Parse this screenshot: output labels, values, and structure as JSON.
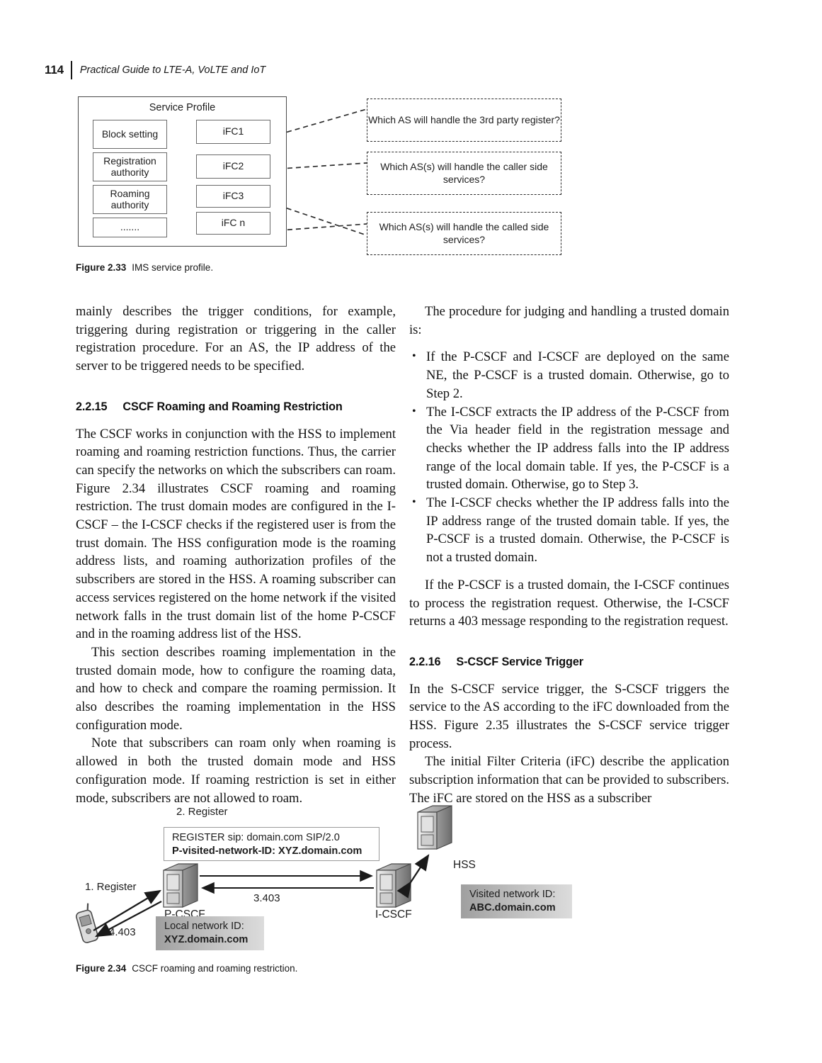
{
  "running_head": {
    "page_number": "114",
    "book_title": "Practical Guide to LTE-A, VoLTE and IoT"
  },
  "figure_233": {
    "caption_label": "Figure 2.33",
    "caption_text": "IMS service profile.",
    "panel_title": "Service Profile",
    "left_boxes": [
      "Block setting",
      "Registration authority",
      "Roaming authority",
      "......."
    ],
    "ifc_boxes": [
      "iFC1",
      "iFC2",
      "iFC3",
      "iFC n"
    ],
    "question_boxes": [
      "Which AS will handle the 3rd party register?",
      "Which AS(s) will handle the caller side services?",
      "Which AS(s) will handle the called side services?"
    ]
  },
  "body": {
    "left_column": {
      "para_1": "mainly describes the trigger conditions, for example, triggering during registration or triggering in the caller registration procedure. For an AS, the IP address of the server to be triggered needs to be specified.",
      "section_number": "2.2.15",
      "section_title": "CSCF Roaming and Roaming Restriction",
      "para_2": "The CSCF works in conjunction with the HSS to implement roaming and roaming restriction functions. Thus, the carrier can specify the networks on which the subscribers can roam. Figure 2.34 illustrates CSCF roaming and roaming restriction. The trust domain modes are configured in the I-CSCF – the I-CSCF checks if the registered user is from the trust domain. The HSS configuration mode is the roaming address lists, and roaming authorization profiles of the subscribers are stored in the HSS. A roaming subscriber can access services registered on the home network if the visited network falls in the trust domain list of the home P-CSCF and in the roaming address list of the HSS.",
      "para_3": "This section describes roaming implementation in the trusted domain mode, how to configure the roaming data, and how to check and compare the roaming permission. It also describes the roaming implementation in the HSS configuration mode.",
      "para_4": "Note that subscribers can roam only when roaming is allowed in both the trusted domain mode and HSS configuration mode. If roaming restriction is set in either mode, subscribers are not allowed to roam."
    },
    "right_column": {
      "para_1": "The procedure for judging and handling a trusted domain is:",
      "bullets": [
        "If the P-CSCF and I-CSCF are deployed on the same NE, the P-CSCF is a trusted domain. Otherwise, go to Step 2.",
        "The I-CSCF extracts the IP address of the P-CSCF from the Via header field in the registration message and checks whether the IP address falls into the IP address range of the local domain table. If yes, the P-CSCF is a trusted domain. Otherwise, go to Step 3.",
        "The I-CSCF checks whether the IP address falls into the IP address range of the trusted domain table. If yes, the P-CSCF is a trusted domain. Otherwise, the P-CSCF is not a trusted domain."
      ],
      "para_2": "If the P-CSCF is a trusted domain, the I-CSCF continues to process the registration request. Otherwise, the I-CSCF returns a 403 message responding to the registration request.",
      "section_number": "2.2.16",
      "section_title": "S-CSCF Service Trigger",
      "para_3": "In the S-CSCF service trigger, the S-CSCF triggers the service to the AS according to the iFC downloaded from the HSS. Figure 2.35 illustrates the S-CSCF service trigger process.",
      "para_4": "The initial Filter Criteria (iFC) describe the application subscription information that can be provided to subscribers. The iFC are stored on the HSS as a subscriber"
    }
  },
  "figure_234": {
    "caption_label": "Figure 2.34",
    "caption_text": "CSCF roaming and roaming restriction.",
    "step_2_label": "2. Register",
    "sip_line_1": "REGISTER sip: domain.com SIP/2.0",
    "sip_line_2": "P-visited-network-ID: XYZ.domain.com",
    "step_1_label": "1. Register",
    "step_3_label": "3.403",
    "step_4_label": "4.403",
    "node_pcscf": "P-CSCF",
    "node_icscf": "I-CSCF",
    "node_hss": "HSS",
    "local_network_title": "Local network ID:",
    "local_network_value": "XYZ.domain.com",
    "visited_network_title": "Visited network ID:",
    "visited_network_value": "ABC.domain.com"
  }
}
